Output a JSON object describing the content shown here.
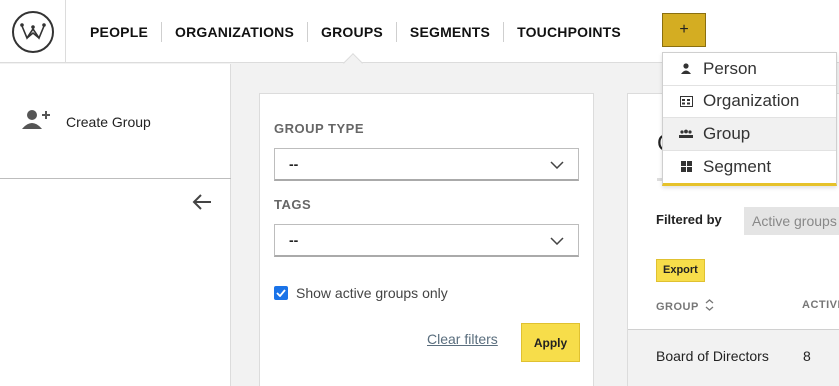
{
  "nav": {
    "logo_icon": "crown-logo-icon",
    "items": [
      "PEOPLE",
      "ORGANIZATIONS",
      "GROUPS",
      "SEGMENTS",
      "TOUCHPOINTS"
    ],
    "active": "GROUPS",
    "plus_label": "+"
  },
  "dropdown": {
    "items": [
      {
        "label": "Person",
        "icon": "person-icon"
      },
      {
        "label": "Organization",
        "icon": "organization-icon"
      },
      {
        "label": "Group",
        "icon": "group-icon"
      },
      {
        "label": "Segment",
        "icon": "segment-icon"
      }
    ],
    "highlighted": "Group"
  },
  "sidebar": {
    "create_group_label": "Create Group",
    "create_group_icon": "add-user-icon",
    "back_icon": "arrow-left-icon"
  },
  "filters": {
    "group_type_label": "GROUP TYPE",
    "group_type_value": "--",
    "tags_label": "TAGS",
    "tags_value": "--",
    "active_only_label": "Show active groups only",
    "active_only_checked": true,
    "clear_label": "Clear filters",
    "apply_label": "Apply"
  },
  "results": {
    "title_partial": "G",
    "filtered_by_label": "Filtered by",
    "filter_chip": "Active groups",
    "export_label": "Export",
    "columns": [
      "GROUP",
      "ACTIVE"
    ],
    "rows": [
      {
        "name": "Board of Directors",
        "active": "8"
      }
    ]
  },
  "colors": {
    "accent_yellow": "#f7dd4a",
    "plus_button": "#d4ad22",
    "checkbox_blue": "#1a73e8"
  }
}
